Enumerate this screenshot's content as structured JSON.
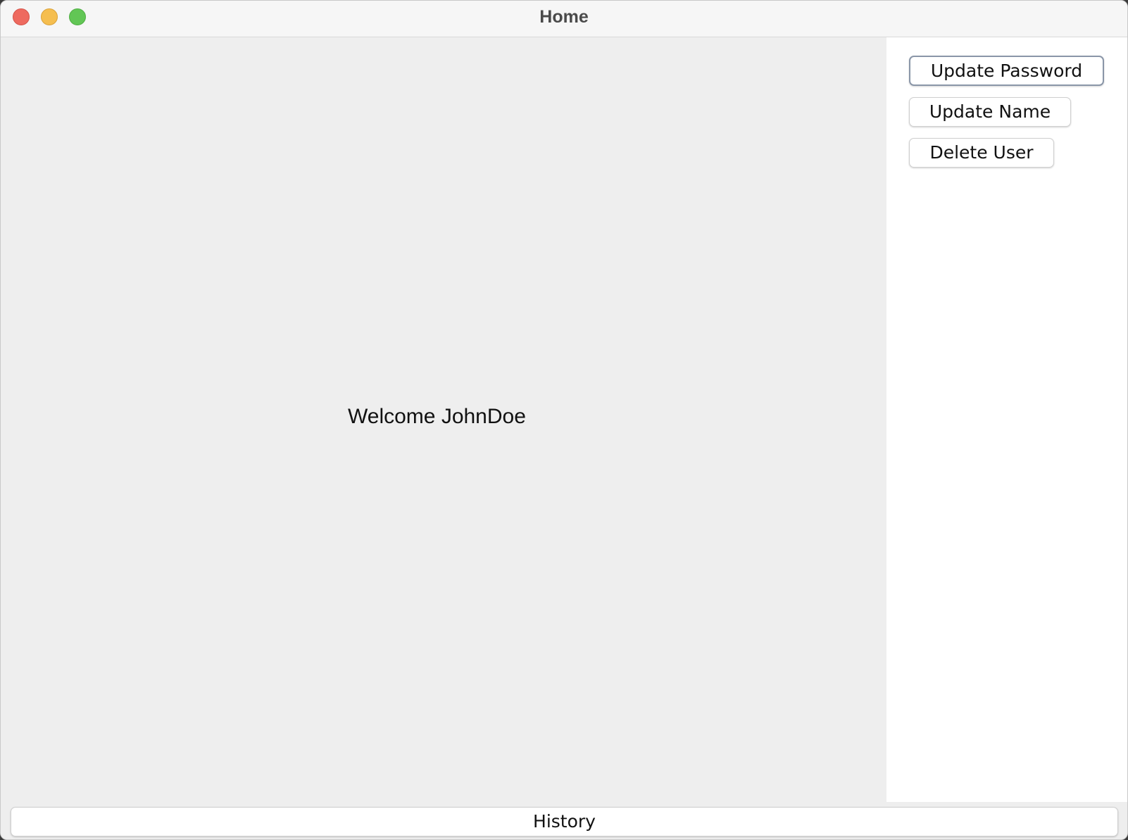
{
  "window": {
    "title": "Home"
  },
  "main": {
    "welcome_text": "Welcome JohnDoe"
  },
  "sidebar": {
    "buttons": [
      {
        "label": "Update Password"
      },
      {
        "label": "Update Name"
      },
      {
        "label": "Delete User"
      }
    ]
  },
  "footer": {
    "history_label": "History"
  },
  "colors": {
    "close": "#ee6a5f",
    "minimize": "#f5be4f",
    "maximize": "#62c655",
    "main_background": "#eeeeee",
    "sidebar_background": "#ffffff",
    "focus_ring": "#8a96a8"
  }
}
